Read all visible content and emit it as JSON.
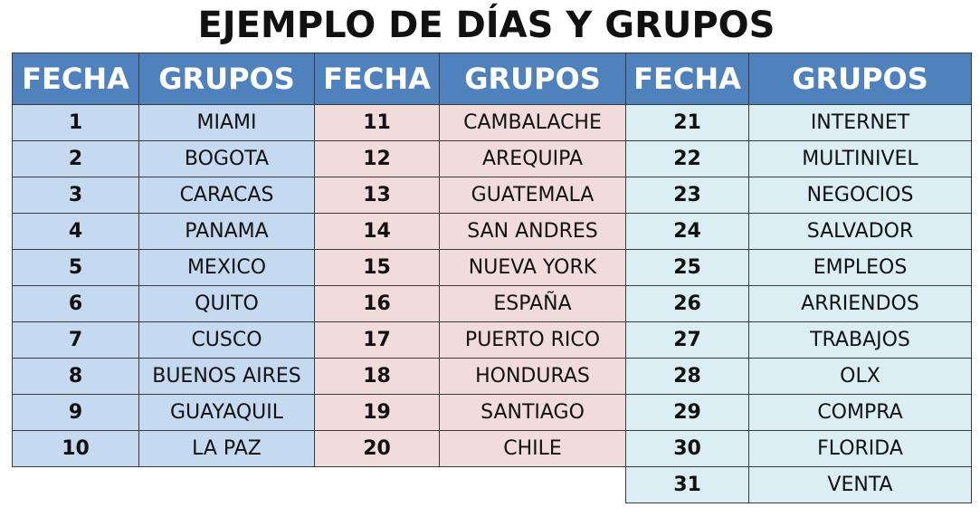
{
  "title": "EJEMPLO DE DÍAS Y GRUPOS",
  "colors": {
    "header_bg": "#4f81bd",
    "header_text": "#ffffff",
    "column_1_bg": "#c5d9f1",
    "column_2_bg": "#f2dcdb",
    "column_3_bg": "#dbeef4",
    "border": "#3a3a3a"
  },
  "tables": [
    {
      "headers": [
        "FECHA",
        "GRUPOS"
      ],
      "rows": [
        {
          "fecha": "1",
          "grupo": "MIAMI"
        },
        {
          "fecha": "2",
          "grupo": "BOGOTA"
        },
        {
          "fecha": "3",
          "grupo": "CARACAS"
        },
        {
          "fecha": "4",
          "grupo": "PANAMA"
        },
        {
          "fecha": "5",
          "grupo": "MEXICO"
        },
        {
          "fecha": "6",
          "grupo": "QUITO"
        },
        {
          "fecha": "7",
          "grupo": "CUSCO"
        },
        {
          "fecha": "8",
          "grupo": "BUENOS AIRES"
        },
        {
          "fecha": "9",
          "grupo": "GUAYAQUIL"
        },
        {
          "fecha": "10",
          "grupo": "LA PAZ"
        }
      ]
    },
    {
      "headers": [
        "FECHA",
        "GRUPOS"
      ],
      "rows": [
        {
          "fecha": "11",
          "grupo": "CAMBALACHE"
        },
        {
          "fecha": "12",
          "grupo": "AREQUIPA"
        },
        {
          "fecha": "13",
          "grupo": "GUATEMALA"
        },
        {
          "fecha": "14",
          "grupo": "SAN ANDRES"
        },
        {
          "fecha": "15",
          "grupo": "NUEVA YORK"
        },
        {
          "fecha": "16",
          "grupo": "ESPAÑA"
        },
        {
          "fecha": "17",
          "grupo": "PUERTO RICO"
        },
        {
          "fecha": "18",
          "grupo": "HONDURAS"
        },
        {
          "fecha": "19",
          "grupo": "SANTIAGO"
        },
        {
          "fecha": "20",
          "grupo": "CHILE"
        }
      ]
    },
    {
      "headers": [
        "FECHA",
        "GRUPOS"
      ],
      "rows": [
        {
          "fecha": "21",
          "grupo": "INTERNET"
        },
        {
          "fecha": "22",
          "grupo": "MULTINIVEL"
        },
        {
          "fecha": "23",
          "grupo": "NEGOCIOS"
        },
        {
          "fecha": "24",
          "grupo": "SALVADOR"
        },
        {
          "fecha": "25",
          "grupo": "EMPLEOS"
        },
        {
          "fecha": "26",
          "grupo": "ARRIENDOS"
        },
        {
          "fecha": "27",
          "grupo": "TRABAJOS"
        },
        {
          "fecha": "28",
          "grupo": "OLX"
        },
        {
          "fecha": "29",
          "grupo": "COMPRA"
        },
        {
          "fecha": "30",
          "grupo": "FLORIDA"
        },
        {
          "fecha": "31",
          "grupo": "VENTA"
        }
      ]
    }
  ]
}
